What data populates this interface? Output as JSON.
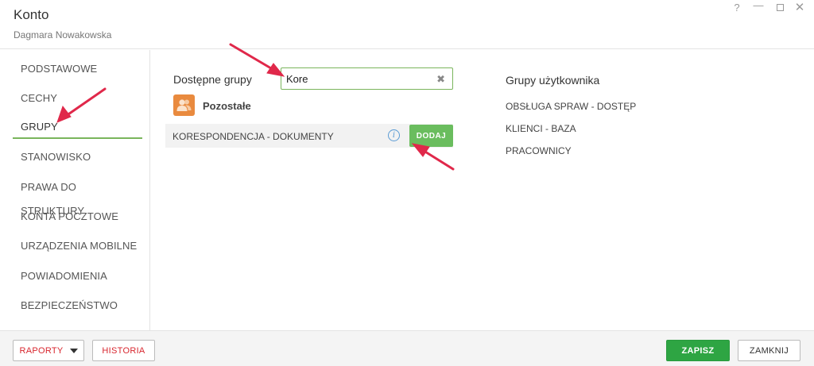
{
  "window": {
    "title": "Konto",
    "subtitle": "Dagmara Nowakowska",
    "controls": {
      "help": "?",
      "minimize": "—",
      "close": "✕"
    }
  },
  "sidebar": {
    "items": [
      {
        "label": "PODSTAWOWE"
      },
      {
        "label": "CECHY"
      },
      {
        "label": "GRUPY",
        "active": true
      },
      {
        "label": "STANOWISKO"
      },
      {
        "label": "PRAWA DO STRUKTURY"
      },
      {
        "label": "KONTA POCZTOWE"
      },
      {
        "label": "URZĄDZENIA MOBILNE"
      },
      {
        "label": "POWIADOMIENIA"
      },
      {
        "label": "BEZPIECZEŃSTWO"
      }
    ]
  },
  "main": {
    "available_label": "Dostępne grupy",
    "search": {
      "value": "Kore",
      "placeholder": ""
    },
    "category": {
      "label": "Pozostałe",
      "icon": "users-icon",
      "color": "#e98a3e"
    },
    "results": [
      {
        "name": "KORESPONDENCJA - DOKUMENTY",
        "add_label": "DODAJ"
      }
    ],
    "user_groups": {
      "title": "Grupy użytkownika",
      "items": [
        "OBSŁUGA SPRAW - DOSTĘP",
        "KLIENCI - BAZA",
        "PRACOWNICY"
      ]
    }
  },
  "footer": {
    "raporty_label": "RAPORTY",
    "historia_label": "HISTORIA",
    "save_label": "ZAPISZ",
    "close_label": "ZAMKNIJ"
  },
  "colors": {
    "accent_green": "#7ab55c",
    "add_button": "#6abd5e",
    "save_button": "#2ea543",
    "footer_text_red": "#d8262e",
    "annotation_arrow": "#e0284a"
  }
}
